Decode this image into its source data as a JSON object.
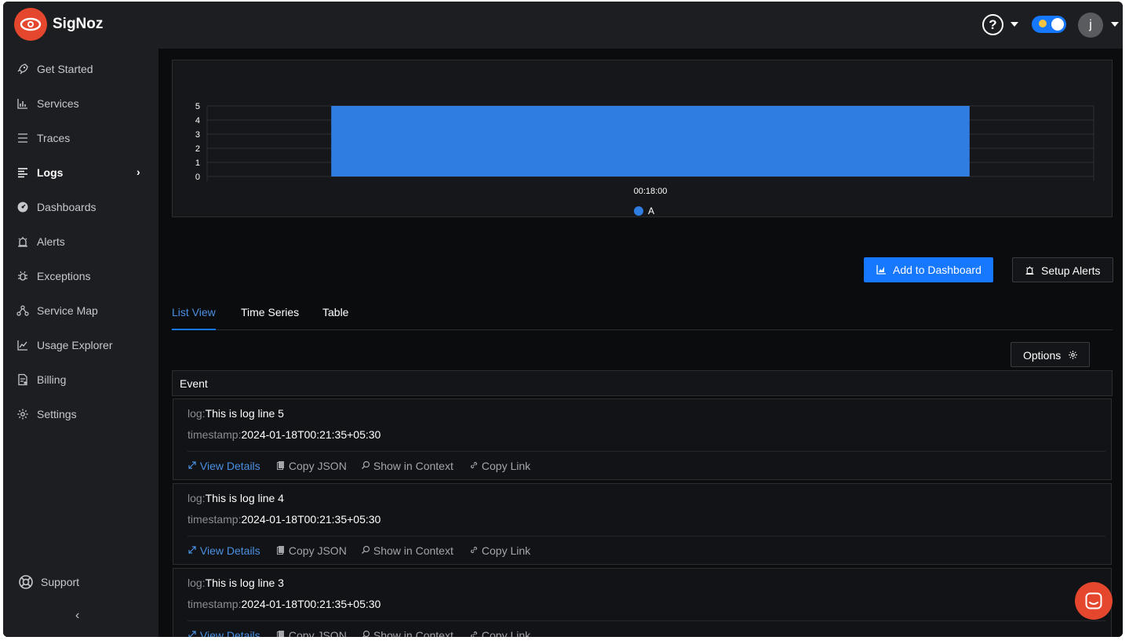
{
  "app": {
    "brand": "SigNoz"
  },
  "header": {
    "help_label": "?",
    "avatar_initial": "j"
  },
  "sidebar": {
    "items": [
      {
        "label": "Get Started",
        "icon": "rocket-icon"
      },
      {
        "label": "Services",
        "icon": "bar-chart-icon"
      },
      {
        "label": "Traces",
        "icon": "list-icon"
      },
      {
        "label": "Logs",
        "icon": "align-left-icon",
        "active": true
      },
      {
        "label": "Dashboards",
        "icon": "dashboard-icon"
      },
      {
        "label": "Alerts",
        "icon": "alarm-icon"
      },
      {
        "label": "Exceptions",
        "icon": "bug-icon"
      },
      {
        "label": "Service Map",
        "icon": "deployment-icon"
      },
      {
        "label": "Usage Explorer",
        "icon": "line-chart-icon"
      },
      {
        "label": "Billing",
        "icon": "file-icon"
      },
      {
        "label": "Settings",
        "icon": "gear-icon"
      }
    ],
    "support_label": "Support",
    "logs_chevron": "›",
    "collapse_glyph": "‹"
  },
  "chart_data": {
    "type": "bar",
    "categories": [
      "00:18:00"
    ],
    "series": [
      {
        "name": "A",
        "values": [
          5
        ]
      }
    ],
    "yticks": [
      "0",
      "1",
      "2",
      "3",
      "4",
      "5"
    ],
    "ylim": [
      0,
      5
    ],
    "grid": true,
    "legend": "bottom-center",
    "color": "#2f7de1"
  },
  "toolbar": {
    "add_dashboard_label": "Add to Dashboard",
    "setup_alerts_label": "Setup Alerts",
    "options_label": "Options"
  },
  "tabs": [
    {
      "label": "List View",
      "active": true
    },
    {
      "label": "Time Series"
    },
    {
      "label": "Table"
    }
  ],
  "table": {
    "header": "Event"
  },
  "logs": [
    {
      "log_key": "log:",
      "log_value": "This is log line 5",
      "ts_key": "timestamp:",
      "ts_value": "2024-01-18T00:21:35+05:30"
    },
    {
      "log_key": "log:",
      "log_value": "This is log line 4",
      "ts_key": "timestamp:",
      "ts_value": "2024-01-18T00:21:35+05:30"
    },
    {
      "log_key": "log:",
      "log_value": "This is log line 3",
      "ts_key": "timestamp:",
      "ts_value": "2024-01-18T00:21:35+05:30"
    }
  ],
  "log_actions": {
    "view_details": "View Details",
    "copy_json": "Copy JSON",
    "show_in_context": "Show in Context",
    "copy_link": "Copy Link"
  },
  "colors": {
    "accent": "#1677ff",
    "brand": "#e4472e",
    "link": "#4a90e2"
  }
}
